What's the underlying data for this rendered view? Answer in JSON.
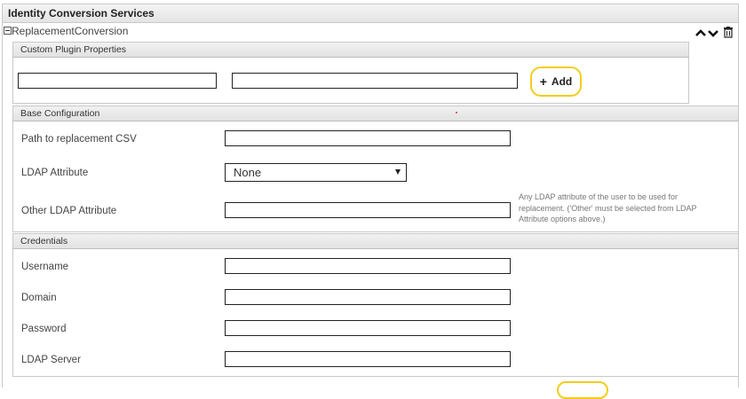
{
  "page": {
    "title": "Identity Conversion Services",
    "plugin_name": "ReplacementConversion"
  },
  "controls": {
    "up_icon": "chevron-up-icon",
    "down_icon": "chevron-down-icon",
    "delete_icon": "trash-icon"
  },
  "custom_plugin_properties": {
    "header": "Custom Plugin Properties",
    "key_value": "",
    "value_value": "",
    "add_label": "Add",
    "add_icon": "plus-icon"
  },
  "base_configuration": {
    "header": "Base Configuration",
    "path_label": "Path to replacement CSV",
    "path_value": "",
    "ldap_attribute_label": "LDAP Attribute",
    "ldap_attribute_selected": "None",
    "other_ldap_label": "Other LDAP Attribute",
    "other_ldap_value": "",
    "other_ldap_help_line1": "Any LDAP attribute of the user to be used for",
    "other_ldap_help_line2": "replacement. ('Other' must be selected from LDAP",
    "other_ldap_help_line3": "Attribute options above.)"
  },
  "credentials": {
    "header": "Credentials",
    "username_label": "Username",
    "username_value": "",
    "domain_label": "Domain",
    "domain_value": "",
    "password_label": "Password",
    "password_value": "",
    "ldap_server_label": "LDAP Server",
    "ldap_server_value": ""
  },
  "colors": {
    "accent_button_border": "#f2cd1c",
    "header_bg": "#e4e4e4"
  }
}
